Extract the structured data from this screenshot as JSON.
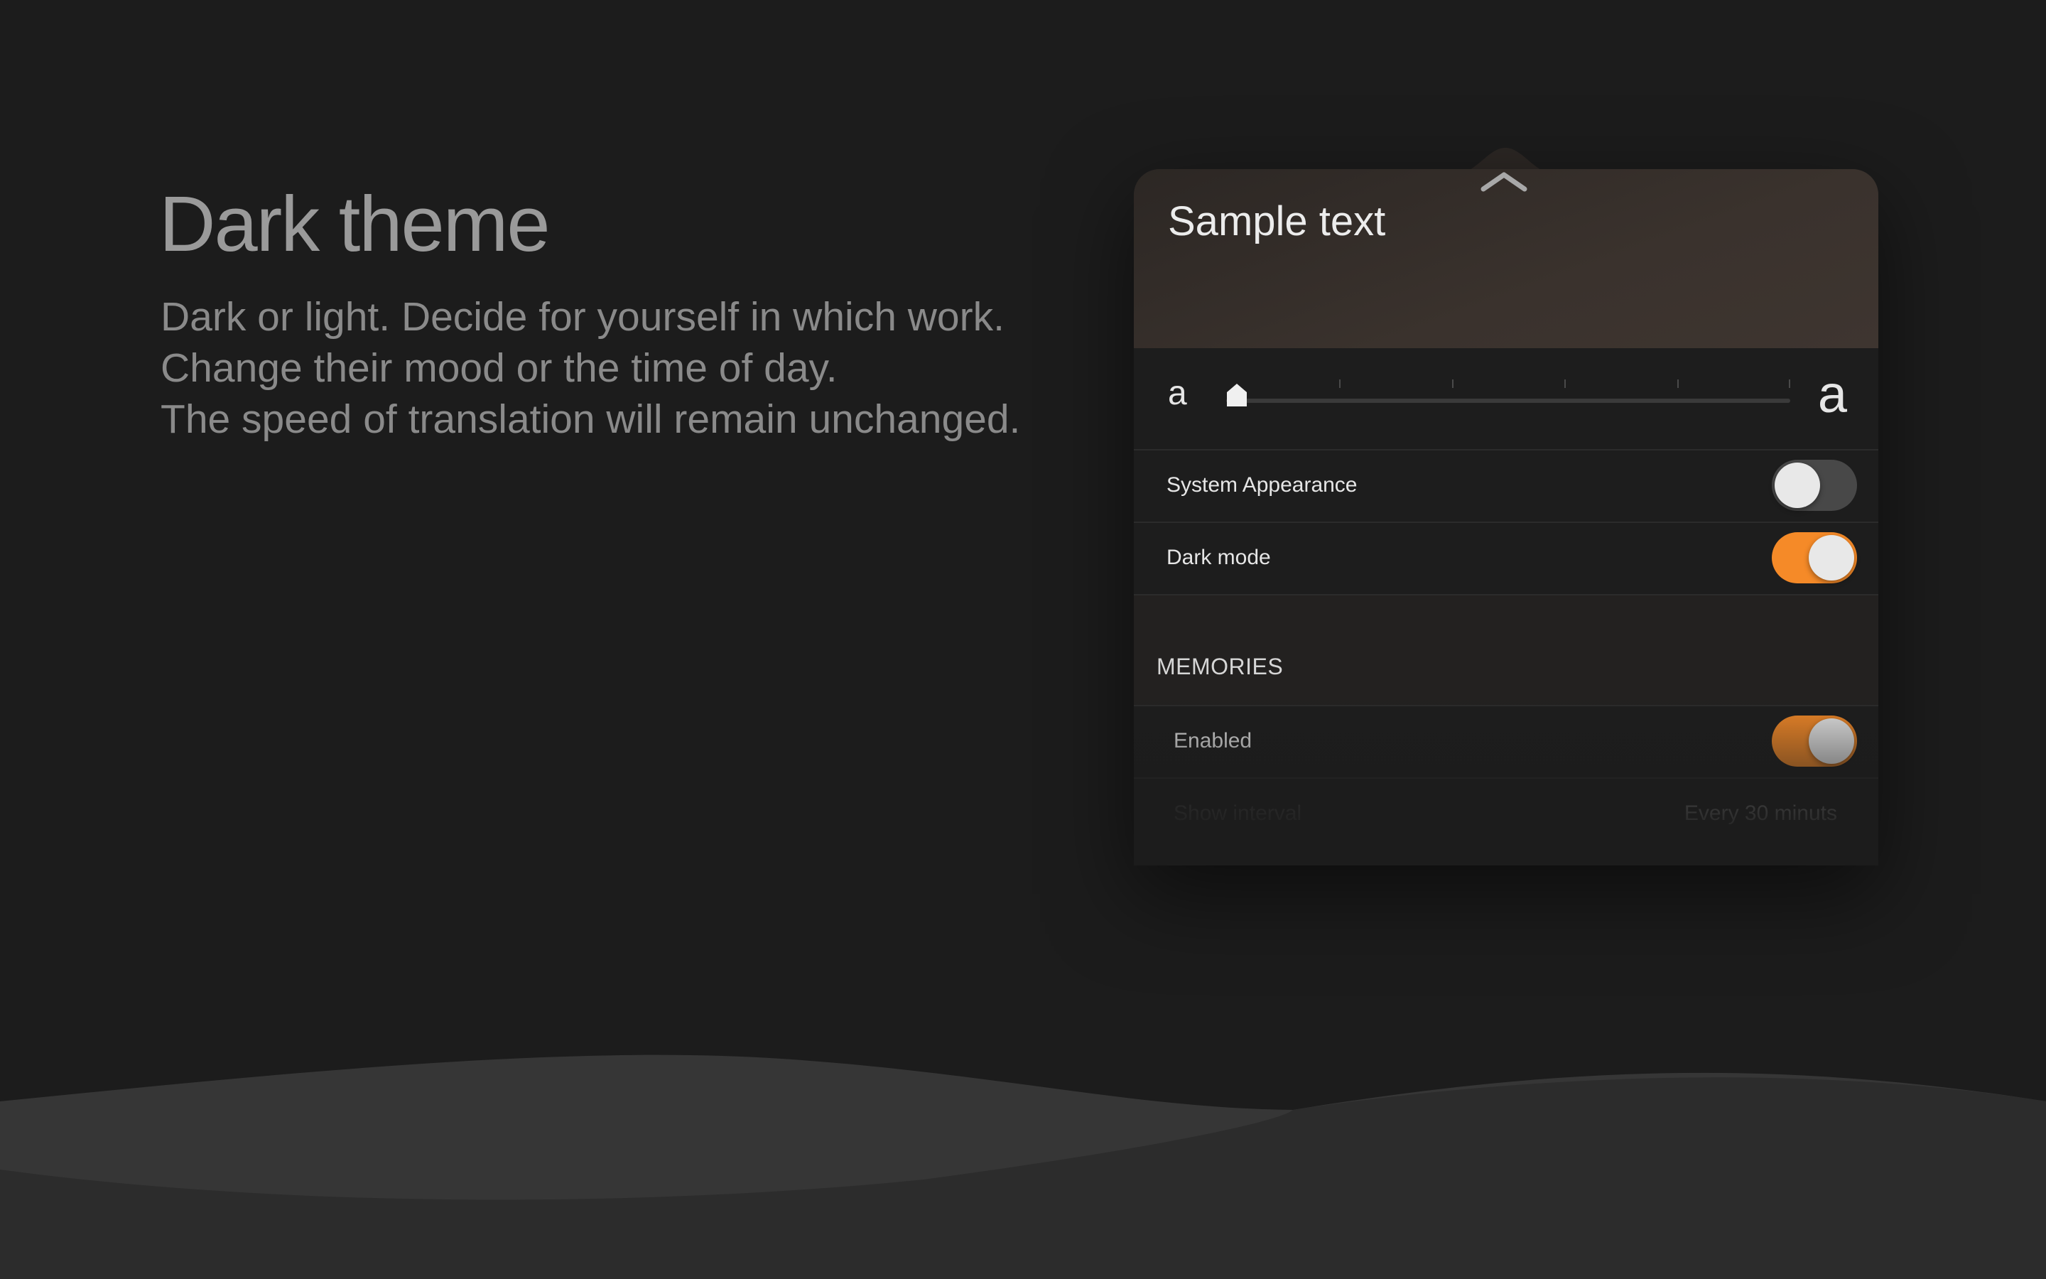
{
  "hero": {
    "title": "Dark theme",
    "description_lines": [
      "Dark or light. Decide for yourself in which work.",
      "Change their mood or the time of day.",
      "The speed of translation will remain unchanged."
    ]
  },
  "popover": {
    "preview_text": "Sample text",
    "font_size": {
      "small_label": "a",
      "large_label": "a",
      "level": 0
    },
    "settings": {
      "system_appearance": {
        "label": "System Appearance",
        "on": false
      },
      "dark_mode": {
        "label": "Dark mode",
        "on": true
      }
    },
    "memories": {
      "header": "MEMORIES",
      "enabled": {
        "label": "Enabled",
        "on": true
      },
      "show_interval": {
        "label": "Show interval",
        "value": "Every 30 minuts"
      }
    }
  },
  "colors": {
    "background": "#1c1c1c",
    "accent": "#f58a28",
    "wave_light": "#363636",
    "wave_dark": "#2c2c2c"
  },
  "icons": {
    "collapse": "chevron-up-icon",
    "slider_thumb": "slider-thumb-icon"
  }
}
